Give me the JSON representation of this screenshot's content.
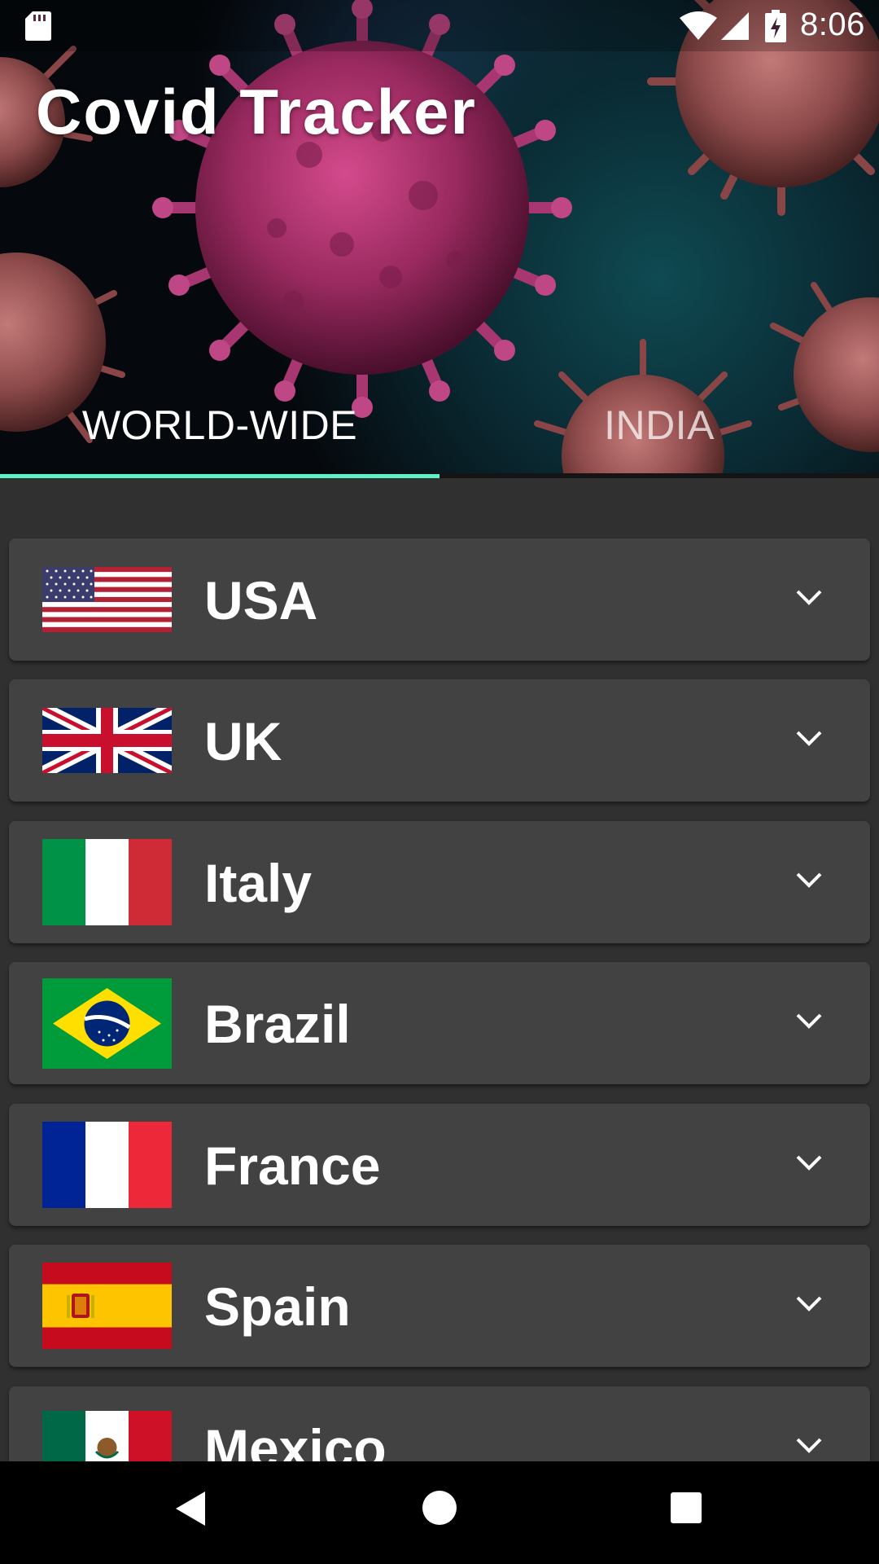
{
  "status_bar": {
    "time": "8:06",
    "icons": [
      "sd-card-icon",
      "wifi-icon",
      "cell-signal-icon",
      "battery-charging-icon"
    ]
  },
  "app": {
    "title": "Covid Tracker"
  },
  "tabs": [
    {
      "label": "WORLD-WIDE",
      "selected": true
    },
    {
      "label": "INDIA",
      "selected": false
    }
  ],
  "accent_color": "#5ff2c8",
  "countries": [
    {
      "name": "USA",
      "flag": "usa-flag"
    },
    {
      "name": "UK",
      "flag": "uk-flag"
    },
    {
      "name": "Italy",
      "flag": "italy-flag"
    },
    {
      "name": "Brazil",
      "flag": "brazil-flag"
    },
    {
      "name": "France",
      "flag": "france-flag"
    },
    {
      "name": "Spain",
      "flag": "spain-flag"
    },
    {
      "name": "Mexico",
      "flag": "mexico-flag"
    }
  ],
  "expand_icon": "chevron-down-icon",
  "nav_bar": {
    "icons": [
      "back-icon",
      "home-icon",
      "recents-icon"
    ]
  }
}
